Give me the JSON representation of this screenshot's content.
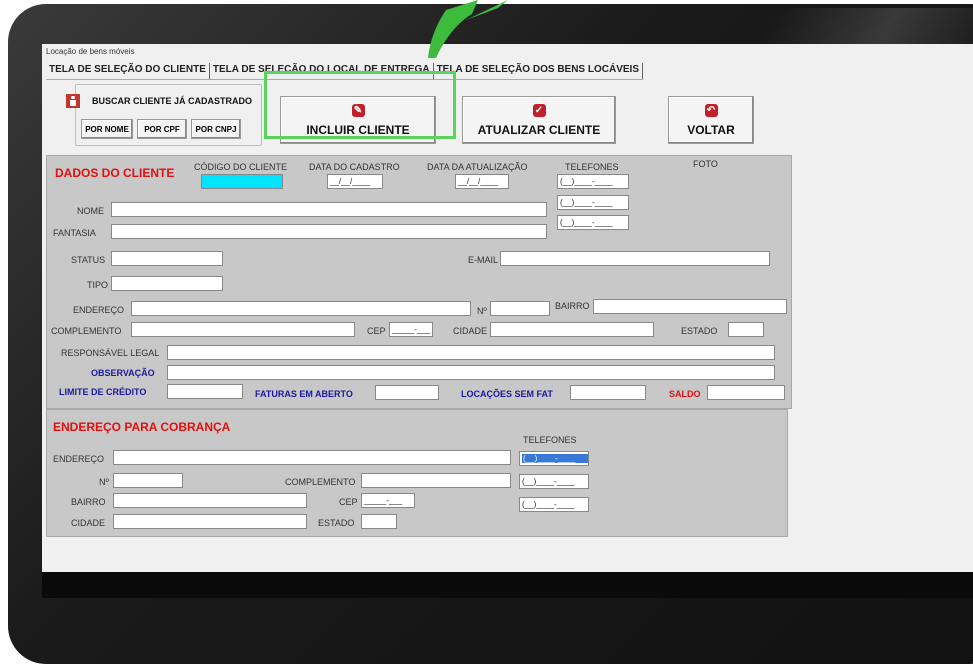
{
  "window": {
    "title": "Locação de bens móveis"
  },
  "tabs": [
    {
      "label": "TELA DE SELEÇÃO DO CLIENTE"
    },
    {
      "label": "TELA DE SELEÇÃO DO LOCAL DE ENTREGA"
    },
    {
      "label": "TELA DE SELEÇÃO DOS BENS LOCÁVEIS"
    }
  ],
  "search": {
    "title": "BUSCAR CLIENTE JÁ CADASTRADO",
    "by_name": "POR NOME",
    "by_cpf": "POR CPF",
    "by_cnpj": "POR CNPJ"
  },
  "actions": {
    "include": "INCLUIR CLIENTE",
    "update": "ATUALIZAR CLIENTE",
    "back": "VOLTAR"
  },
  "client": {
    "section_title": "DADOS DO CLIENTE",
    "code_label": "CÓDIGO DO CLIENTE",
    "reg_date_label": "DATA DO CADASTRO",
    "reg_date_value": "__/__/____",
    "upd_date_label": "DATA DA ATUALIZAÇÃO",
    "upd_date_value": "__/__/____",
    "phones_label": "TELEFONES",
    "phone_mask": "(__)____-____",
    "photo_label": "FOTO",
    "name_label": "NOME",
    "fantasy_label": "FANTASIA",
    "status_label": "STATUS",
    "email_label": "E-MAIL",
    "type_label": "TIPO",
    "address_label": "ENDEREÇO",
    "number_label": "Nº",
    "district_label": "BAIRRO",
    "complement_label": "COMPLEMENTO",
    "cep_label": "CEP",
    "cep_mask": "_____-___",
    "city_label": "CIDADE",
    "state_label": "ESTADO",
    "legal_label": "RESPONSÁVEL LEGAL",
    "obs_label": "OBSERVAÇÃO",
    "credit_label": "LIMITE DE CRÉDITO",
    "open_invoices_label": "FATURAS EM ABERTO",
    "rentals_label": "LOCAÇÕES SEM FAT",
    "balance_label": "SALDO"
  },
  "billing": {
    "section_title": "ENDEREÇO PARA COBRANÇA",
    "phones_label": "TELEFONES",
    "phone_mask": "(__)____-____",
    "address_label": "ENDEREÇO",
    "number_label": "Nº",
    "complement_label": "COMPLEMENTO",
    "district_label": "BAIRRO",
    "cep_label": "CEP",
    "cep_mask": "_____-___",
    "city_label": "CIDADE",
    "state_label": "ESTADO"
  },
  "colors": {
    "highlight": "#5bd45b",
    "section_red": "#e01010",
    "label_blue": "#1a1aa0",
    "code_field": "#00e5ff"
  }
}
